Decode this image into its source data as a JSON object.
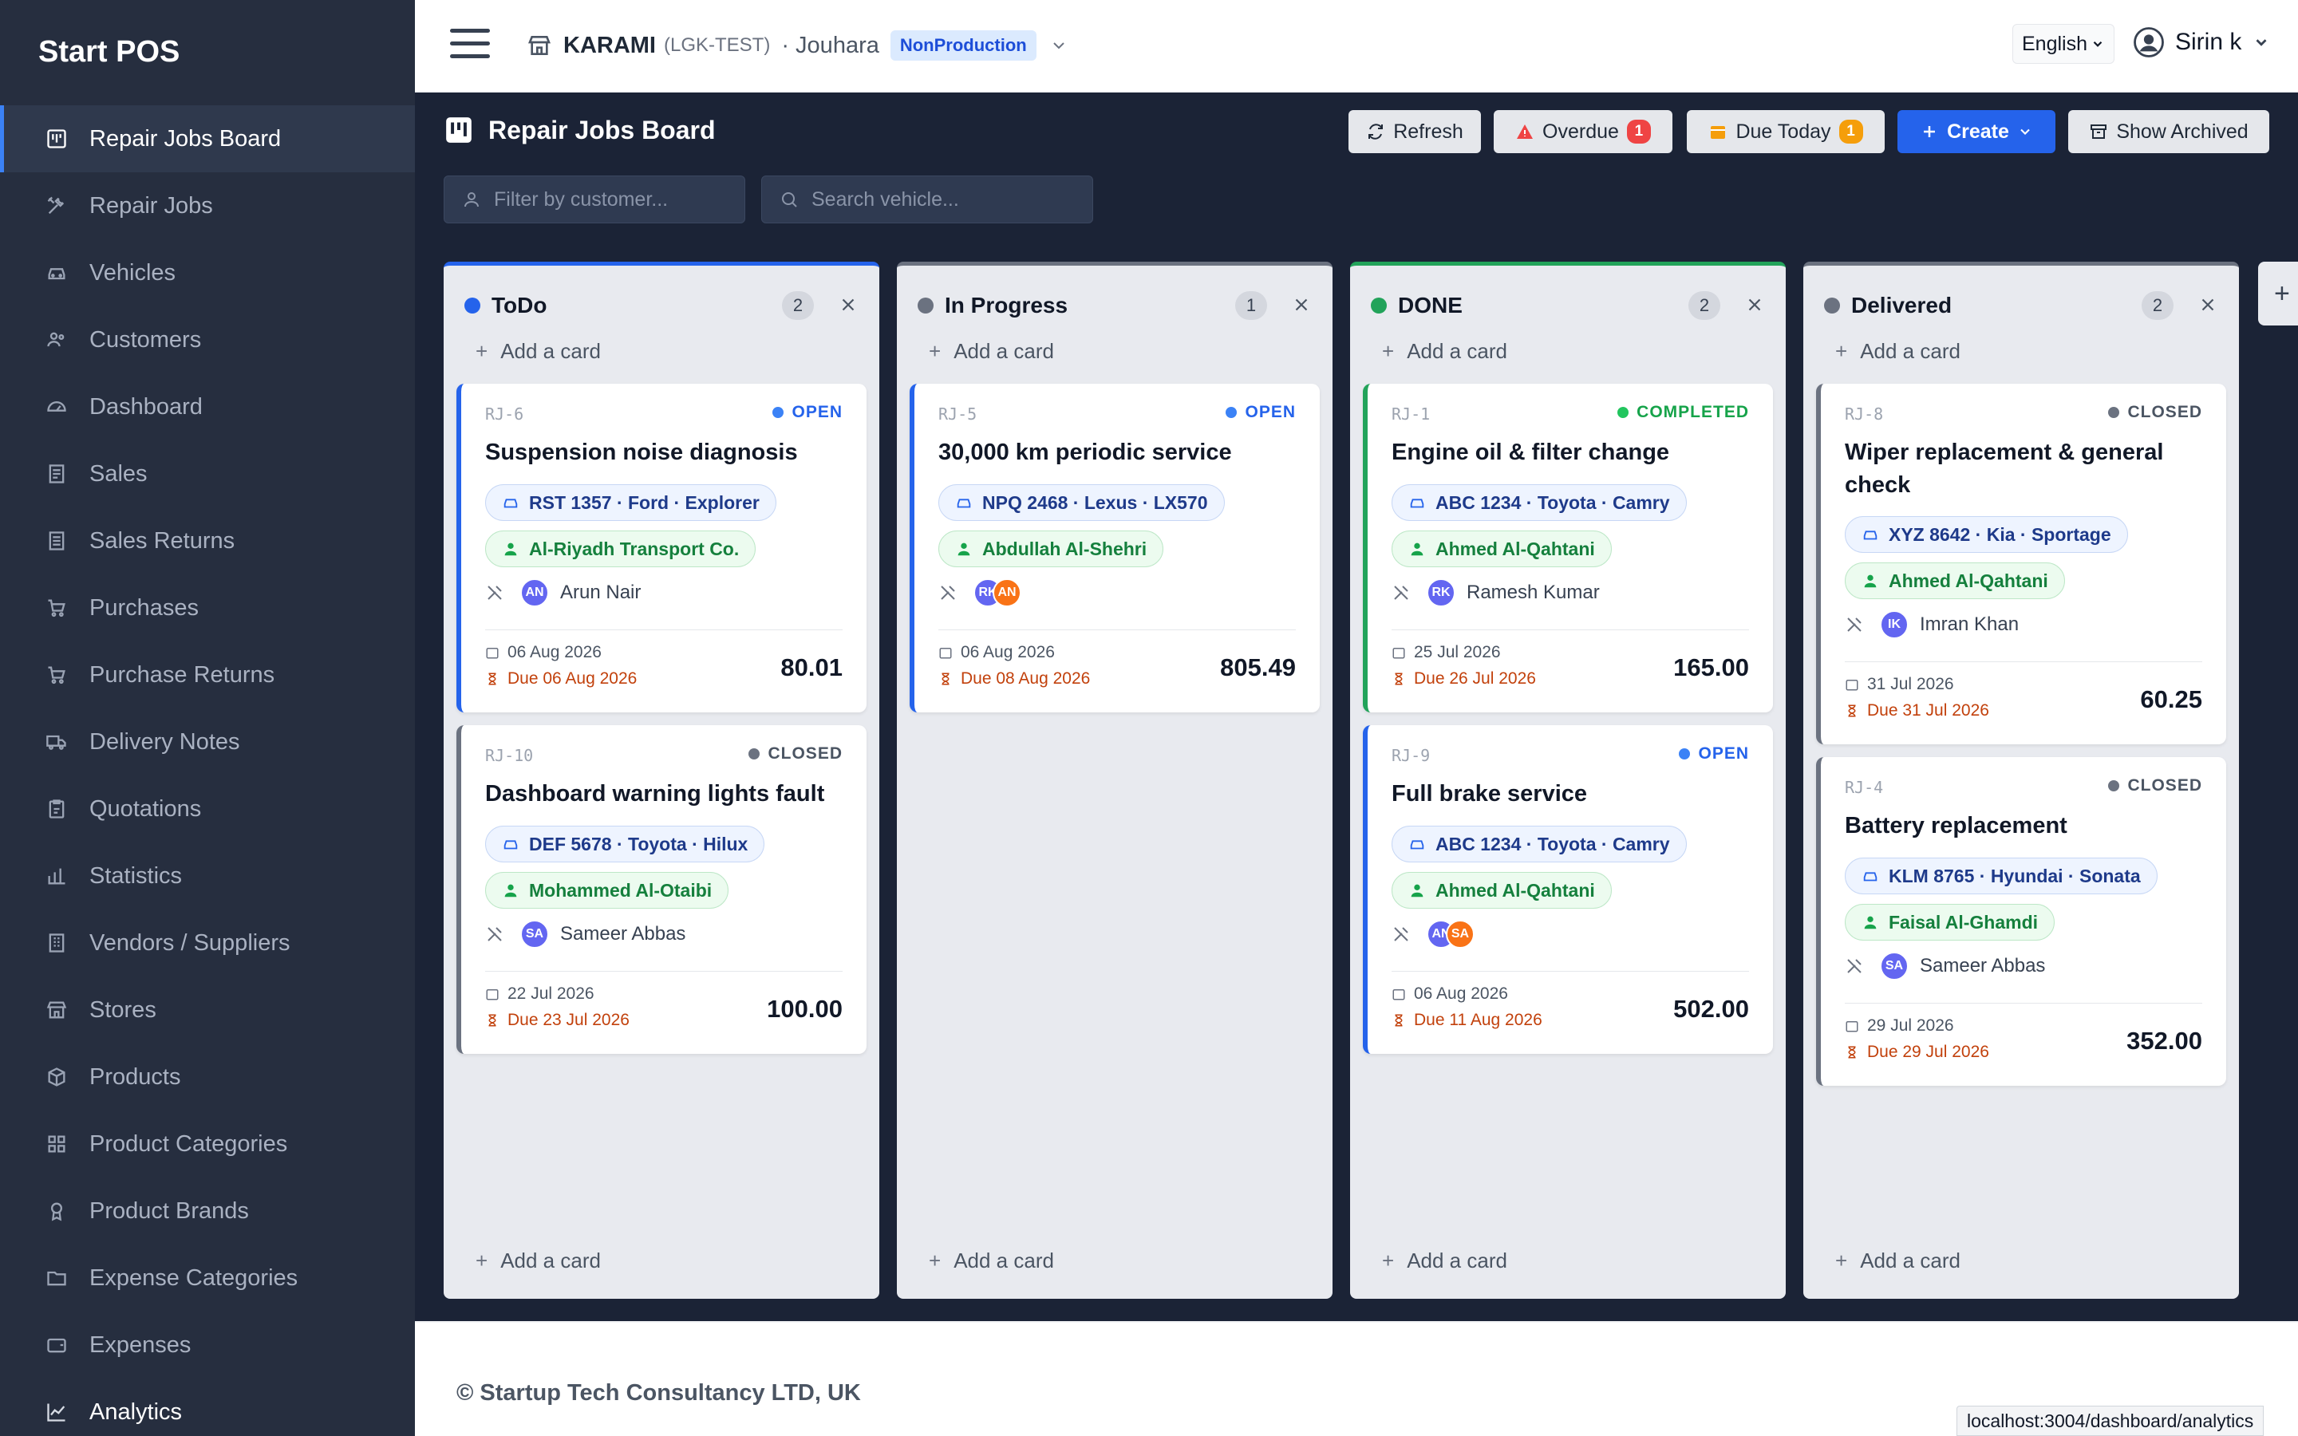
{
  "app": {
    "brand": "Start POS"
  },
  "sidebar": {
    "items": [
      {
        "label": "Repair Jobs Board",
        "icon": "kanban-icon",
        "active": true
      },
      {
        "label": "Repair Jobs",
        "icon": "tools-icon"
      },
      {
        "label": "Vehicles",
        "icon": "car-icon"
      },
      {
        "label": "Customers",
        "icon": "users-icon"
      },
      {
        "label": "Dashboard",
        "icon": "gauge-icon"
      },
      {
        "label": "Sales",
        "icon": "receipt-icon"
      },
      {
        "label": "Sales Returns",
        "icon": "receipt-return-icon"
      },
      {
        "label": "Purchases",
        "icon": "cart-icon"
      },
      {
        "label": "Purchase Returns",
        "icon": "cart-return-icon"
      },
      {
        "label": "Delivery Notes",
        "icon": "truck-icon"
      },
      {
        "label": "Quotations",
        "icon": "clipboard-icon"
      },
      {
        "label": "Statistics",
        "icon": "bar-chart-icon"
      },
      {
        "label": "Vendors / Suppliers",
        "icon": "building-icon"
      },
      {
        "label": "Stores",
        "icon": "store-icon"
      },
      {
        "label": "Products",
        "icon": "box-icon"
      },
      {
        "label": "Product Categories",
        "icon": "grid-icon"
      },
      {
        "label": "Product Brands",
        "icon": "badge-icon"
      },
      {
        "label": "Expense Categories",
        "icon": "folder-icon"
      },
      {
        "label": "Expenses",
        "icon": "wallet-icon"
      },
      {
        "label": "Analytics",
        "icon": "line-chart-icon"
      }
    ]
  },
  "topbar": {
    "org_name": "KARAMI",
    "org_code": "(LGK-TEST)",
    "branch": "· Jouhara",
    "environment": "NonProduction",
    "language": "English",
    "user": "Sirin k"
  },
  "board": {
    "title": "Repair Jobs Board",
    "buttons": {
      "refresh": "Refresh",
      "overdue": "Overdue",
      "overdue_count": "1",
      "due_today": "Due Today",
      "due_today_count": "1",
      "create": "Create",
      "show_archived": "Show Archived"
    },
    "filters": {
      "customer_placeholder": "Filter by customer...",
      "vehicle_placeholder": "Search vehicle..."
    },
    "add_card": "Add a card",
    "colors": {
      "open": "#2563eb",
      "closed": "#6b7280",
      "completed": "#22a35a",
      "due": "#c2410c"
    },
    "columns": [
      {
        "title": "ToDo",
        "count": "2",
        "cards": [
          {
            "id": "RJ-6",
            "status": "OPEN",
            "title": "Suspension noise diagnosis",
            "vehicle": "RST 1357 · Ford · Explorer",
            "customer": "Al-Riyadh Transport Co.",
            "technicians": [
              {
                "initials": "AN"
              }
            ],
            "technician_name": "Arun Nair",
            "created": "06 Aug 2026",
            "due": "Due 06 Aug 2026",
            "amount": "80.01"
          },
          {
            "id": "RJ-10",
            "status": "CLOSED",
            "title": "Dashboard warning lights fault",
            "vehicle": "DEF 5678 · Toyota · Hilux",
            "customer": "Mohammed Al-Otaibi",
            "technicians": [
              {
                "initials": "SA"
              }
            ],
            "technician_name": "Sameer Abbas",
            "created": "22 Jul 2026",
            "due": "Due 23 Jul 2026",
            "amount": "100.00"
          }
        ]
      },
      {
        "title": "In Progress",
        "count": "1",
        "cards": [
          {
            "id": "RJ-5",
            "status": "OPEN",
            "title": "30,000 km periodic service",
            "vehicle": "NPQ 2468 · Lexus · LX570",
            "customer": "Abdullah Al-Shehri",
            "technicians": [
              {
                "initials": "RK"
              },
              {
                "initials": "AN"
              }
            ],
            "technician_name": "",
            "created": "06 Aug 2026",
            "due": "Due 08 Aug 2026",
            "amount": "805.49"
          }
        ]
      },
      {
        "title": "DONE",
        "count": "2",
        "cards": [
          {
            "id": "RJ-1",
            "status": "COMPLETED",
            "title": "Engine oil & filter change",
            "vehicle": "ABC 1234 · Toyota · Camry",
            "customer": "Ahmed Al-Qahtani",
            "technicians": [
              {
                "initials": "RK"
              }
            ],
            "technician_name": "Ramesh Kumar",
            "created": "25 Jul 2026",
            "due": "Due 26 Jul 2026",
            "amount": "165.00"
          },
          {
            "id": "RJ-9",
            "status": "OPEN",
            "title": "Full brake service",
            "vehicle": "ABC 1234 · Toyota · Camry",
            "customer": "Ahmed Al-Qahtani",
            "technicians": [
              {
                "initials": "AN"
              },
              {
                "initials": "SA"
              }
            ],
            "technician_name": "",
            "created": "06 Aug 2026",
            "due": "Due 11 Aug 2026",
            "amount": "502.00"
          }
        ]
      },
      {
        "title": "Delivered",
        "count": "2",
        "cards": [
          {
            "id": "RJ-8",
            "status": "CLOSED",
            "title": "Wiper replacement & general check",
            "vehicle": "XYZ 8642 · Kia · Sportage",
            "customer": "Ahmed Al-Qahtani",
            "technicians": [
              {
                "initials": "IK"
              }
            ],
            "technician_name": "Imran Khan",
            "created": "31 Jul 2026",
            "due": "Due 31 Jul 2026",
            "amount": "60.25"
          },
          {
            "id": "RJ-4",
            "status": "CLOSED",
            "title": "Battery replacement",
            "vehicle": "KLM 8765 · Hyundai · Sonata",
            "customer": "Faisal Al-Ghamdi",
            "technicians": [
              {
                "initials": "SA"
              }
            ],
            "technician_name": "Sameer Abbas",
            "created": "29 Jul 2026",
            "due": "Due 29 Jul 2026",
            "amount": "352.00"
          }
        ]
      }
    ]
  },
  "footer": {
    "text": "© Startup Tech Consultancy LTD, UK"
  },
  "status_url": "localhost:3004/dashboard/analytics"
}
